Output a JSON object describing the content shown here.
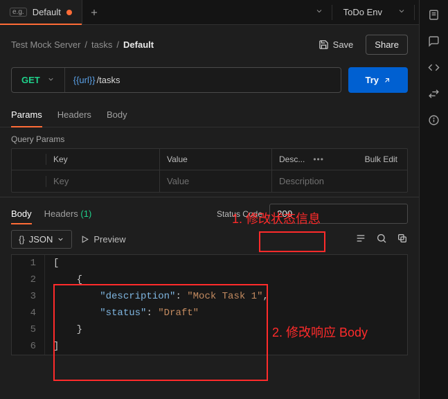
{
  "tabbar": {
    "active_tab": {
      "badge": "e.g.",
      "label": "Default"
    },
    "environment": "ToDo Env"
  },
  "breadcrumb": {
    "seg0": "Test Mock Server",
    "seg1": "tasks",
    "current": "Default"
  },
  "actions": {
    "save": "Save",
    "share": "Share"
  },
  "request": {
    "method": "GET",
    "url_var": "{{url}}",
    "url_path": " /tasks",
    "try": "Try"
  },
  "req_tabs": {
    "params": "Params",
    "headers": "Headers",
    "body": "Body"
  },
  "query_params": {
    "title": "Query Params",
    "col_key": "Key",
    "col_value": "Value",
    "col_desc": "Desc...",
    "more": "•••",
    "bulk": "Bulk Edit",
    "ph_key": "Key",
    "ph_value": "Value",
    "ph_desc": "Description"
  },
  "response": {
    "tab_body": "Body",
    "tab_headers": "Headers",
    "headers_count": "(1)",
    "status_label": "Status Code",
    "status_value": "200 ",
    "json_label": "JSON",
    "preview": "Preview"
  },
  "code": {
    "l1": "[",
    "l2": "    {",
    "l3a": "        ",
    "l3_key": "\"description\"",
    "l3b": ": ",
    "l3_val": "\"Mock Task 1\"",
    "l3c": ",",
    "l4a": "        ",
    "l4_key": "\"status\"",
    "l4b": ": ",
    "l4_val": "\"Draft\"",
    "l5": "    }",
    "l6": "]",
    "ln1": "1",
    "ln2": "2",
    "ln3": "3",
    "ln4": "4",
    "ln5": "5",
    "ln6": "6"
  },
  "annotations": {
    "a1": "1. 修改状态信息",
    "a2": "2. 修改响应 Body"
  }
}
